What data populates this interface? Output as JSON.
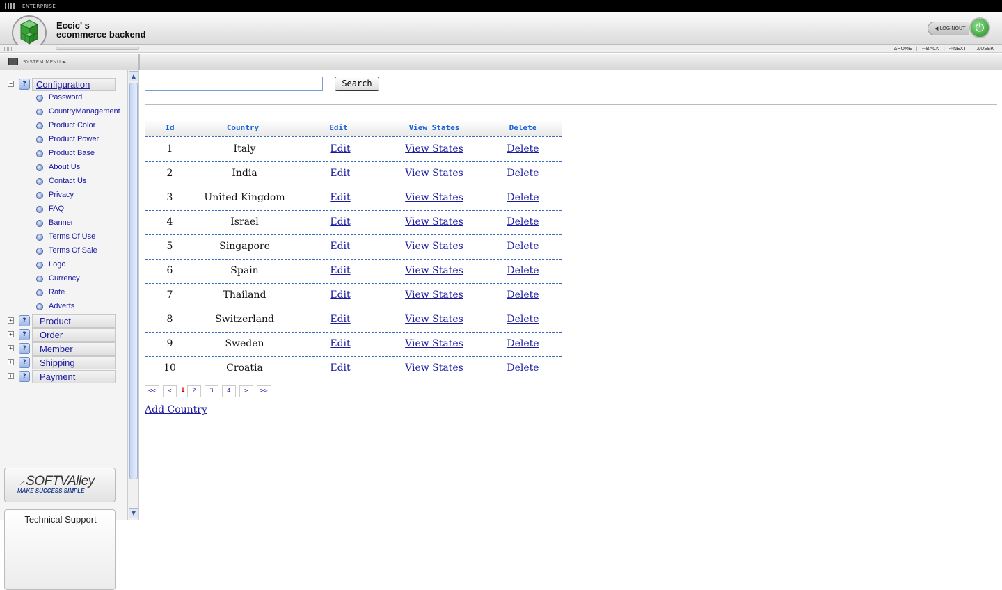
{
  "topbar": {
    "env_label": "ENTERPRISE"
  },
  "header": {
    "brand_line1": "Eccic' s",
    "brand_line2": "ecommerce backend",
    "logout_label": "LOGINOUT"
  },
  "topnav": {
    "home": "HOME",
    "back": "BACK",
    "next": "NEXT",
    "user": "USER"
  },
  "sysbar": {
    "label": "SYSTEM MENU ►"
  },
  "sidebar": {
    "configuration": "Configuration",
    "config_items": [
      "Password",
      "CountryManagement",
      "Product Color",
      "Product Power",
      "Product Base",
      "About Us",
      "Contact Us",
      "Privacy",
      "FAQ",
      "Banner",
      "Terms Of Use",
      "Terms Of Sale",
      "Logo",
      "Currency",
      "Rate",
      "Adverts"
    ],
    "sections": [
      "Product",
      "Order",
      "Member",
      "Shipping",
      "Payment"
    ],
    "softvalley_logo": "SOFTVAlley",
    "softvalley_tagline": "MAKE SUCCESS SIMPLE",
    "tech_support": "Technical Support"
  },
  "search": {
    "value": "",
    "placeholder": "",
    "button_label": "Search"
  },
  "table": {
    "headers": [
      "Id",
      "Country",
      "Edit",
      "View States",
      "Delete"
    ],
    "rows": [
      {
        "id": "1",
        "country": "Italy",
        "edit": "Edit",
        "view": "View States",
        "delete": "Delete"
      },
      {
        "id": "2",
        "country": "India",
        "edit": "Edit",
        "view": "View States",
        "delete": "Delete"
      },
      {
        "id": "3",
        "country": "United Kingdom",
        "edit": "Edit",
        "view": "View States",
        "delete": "Delete"
      },
      {
        "id": "4",
        "country": "Israel",
        "edit": "Edit",
        "view": "View States",
        "delete": "Delete"
      },
      {
        "id": "5",
        "country": "Singapore",
        "edit": "Edit",
        "view": "View States",
        "delete": "Delete"
      },
      {
        "id": "6",
        "country": "Spain",
        "edit": "Edit",
        "view": "View States",
        "delete": "Delete"
      },
      {
        "id": "7",
        "country": "Thailand",
        "edit": "Edit",
        "view": "View States",
        "delete": "Delete"
      },
      {
        "id": "8",
        "country": "Switzerland",
        "edit": "Edit",
        "view": "View States",
        "delete": "Delete"
      },
      {
        "id": "9",
        "country": "Sweden",
        "edit": "Edit",
        "view": "View States",
        "delete": "Delete"
      },
      {
        "id": "10",
        "country": "Croatia",
        "edit": "Edit",
        "view": "View States",
        "delete": "Delete"
      }
    ]
  },
  "pager": {
    "first": "<<",
    "prev": "<",
    "current": "1",
    "pages": [
      "2",
      "3",
      "4"
    ],
    "next": ">",
    "last": ">>"
  },
  "add_country": "Add Country"
}
